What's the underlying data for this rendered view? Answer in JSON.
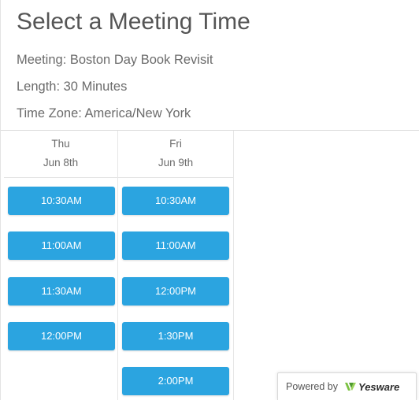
{
  "title": "Select a Meeting Time",
  "meeting": "Meeting: Boston Day Book Revisit",
  "length": "Length: 30 Minutes",
  "time_zone": "Time Zone: America/New York",
  "days": [
    {
      "name": "Thu",
      "date": "Jun 8th",
      "slots": [
        "10:30AM",
        "11:00AM",
        "11:30AM",
        "12:00PM"
      ]
    },
    {
      "name": "Fri",
      "date": "Jun 9th",
      "slots": [
        "10:30AM",
        "11:00AM",
        "12:00PM",
        "1:30PM",
        "2:00PM"
      ]
    }
  ],
  "footer": {
    "powered_by": "Powered by",
    "brand": "Yesware"
  },
  "colors": {
    "slot_button": "#2ba4e0",
    "title_text": "#555555",
    "brand_green": "#7cc242"
  },
  "icons": {
    "brand_logo": "yesware-logo-icon"
  }
}
